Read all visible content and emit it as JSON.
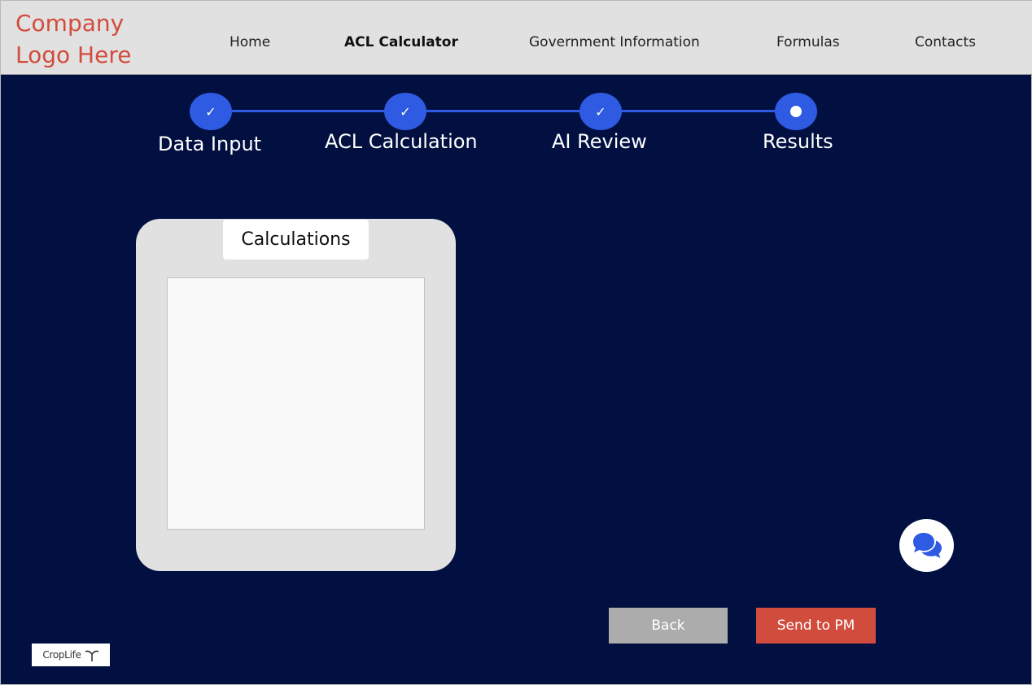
{
  "header": {
    "logo_line1": "Company",
    "logo_line2": "Logo Here",
    "nav": [
      {
        "label": "Home"
      },
      {
        "label": "ACL Calculator"
      },
      {
        "label": "Government Information"
      },
      {
        "label": "Formulas"
      },
      {
        "label": "Contacts"
      }
    ],
    "active_nav": "ACL Calculator"
  },
  "stepper": {
    "steps": [
      {
        "label": "Data Input",
        "status": "complete",
        "icon": "check-icon"
      },
      {
        "label": "ACL Calculation",
        "status": "complete",
        "icon": "check-icon"
      },
      {
        "label": "AI Review",
        "status": "complete",
        "icon": "check-icon"
      },
      {
        "label": "Results",
        "status": "current",
        "icon": "dot-icon"
      }
    ]
  },
  "calculations": {
    "title": "Calculations",
    "content": ""
  },
  "chat": {
    "icon": "chat-bubbles-icon"
  },
  "actions": {
    "back_label": "Back",
    "send_label": "Send to PM"
  },
  "footer": {
    "brand_logo_text": "CropLife"
  },
  "colors": {
    "background": "#021041",
    "header_bg": "#e1e1e1",
    "accent_blue": "#2f5be3",
    "brand_red": "#d24c3d",
    "button_gray": "#acacac",
    "card_gray": "#e1e1e1"
  }
}
